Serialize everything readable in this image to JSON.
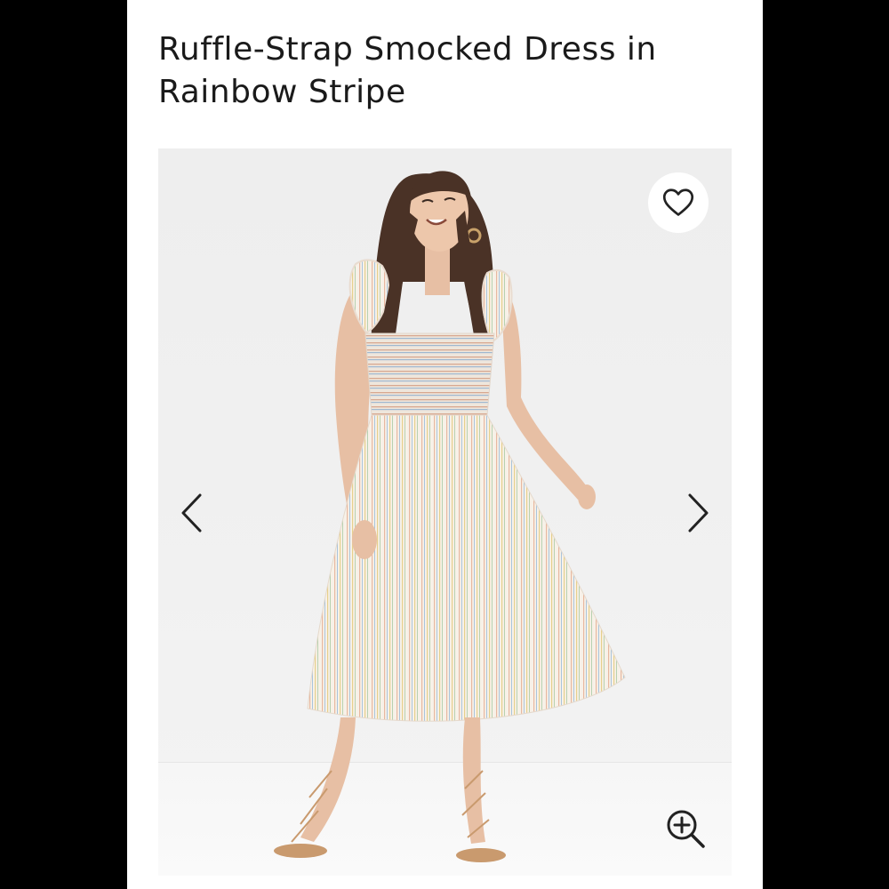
{
  "product": {
    "title": "Ruffle-Strap Smocked Dress in Rainbow Stripe"
  },
  "gallery": {
    "image_alt": "Model wearing a cream ruffle-strap smocked midi dress with thin rainbow stripes and lace-up sandals",
    "icons": {
      "favorite": "heart-outline-icon",
      "previous": "chevron-left-icon",
      "next": "chevron-right-icon",
      "zoom": "zoom-in-icon"
    }
  },
  "colors": {
    "frame": "#000000",
    "page_background": "#ffffff",
    "text": "#1a1a1a",
    "gallery_background": "#efefef",
    "icon": "#222222"
  }
}
